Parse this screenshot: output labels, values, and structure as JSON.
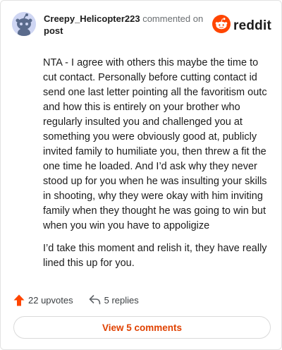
{
  "header": {
    "username": "Creepy_Helicopter223",
    "commented_on": "commented on",
    "post_link": "post",
    "logo_text": "reddit",
    "avatar_icon": "snoo-avatar-icon",
    "logo_icon": "reddit-logo-icon"
  },
  "comment": {
    "paragraphs": [
      "NTA - I agree with others this maybe the time to cut contact. Personally before cutting contact id send one last letter pointing all the favoritism outc and how this is entirely on your brother who regularly insulted you and challenged you at something you were obviously good at, publicly invited family to humiliate you, then threw a fit the one time he loaded. And I’d ask why they never stood up for you when he was insulting your skills in shooting, why they were okay with him inviting family when they thought he was going to win but when you win you have to appoligize",
      "I’d take this moment and relish it, they have really lined this up for you."
    ]
  },
  "actions": {
    "upvotes_label": "22 upvotes",
    "replies_label": "5 replies",
    "upvote_icon": "upvote-arrow-icon",
    "reply_icon": "reply-arrow-icon"
  },
  "view_comments_label": "View 5 comments",
  "colors": {
    "accent": "#ff4500",
    "button_text": "#e04100",
    "avatar_bg": "#cfd6f3"
  }
}
